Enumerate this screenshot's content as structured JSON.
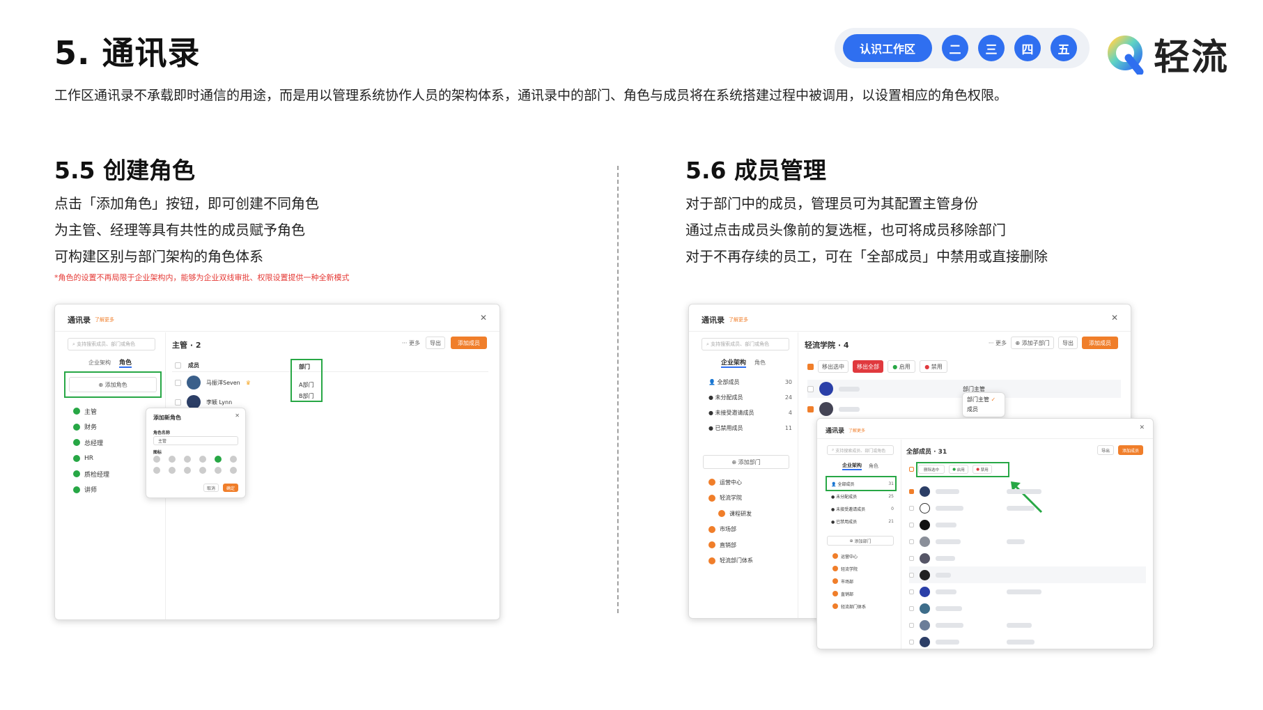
{
  "header": {
    "title": "5. 通讯录",
    "description": "工作区通讯录不承载即时通信的用途，而是用以管理系统协作人员的架构体系，通讯录中的部门、角色与成员将在系统搭建过程中被调用，以设置相应的角色权限。",
    "steps": [
      "认识工作区",
      "二",
      "三",
      "四",
      "五"
    ],
    "logo_text": "轻流"
  },
  "left": {
    "title": "5.5 创建角色",
    "lines": [
      "点击「添加角色」按钮，即可创建不同角色",
      "为主管、经理等具有共性的成员赋予角色",
      "可构建区别与部门架构的角色体系"
    ],
    "note": "*角色的设置不再局限于企业架构内，能够为企业双线审批、权限设置提供一种全新模式",
    "app": {
      "window_title": "通讯录",
      "learn_more": "了解更多",
      "search_placeholder": "支持搜索成员、部门或角色",
      "tabs": [
        "企业架构",
        "角色"
      ],
      "add_role": "添加角色",
      "roles": [
        "主管",
        "财务",
        "总经理",
        "HR",
        "质检经理",
        "讲师"
      ],
      "list_title": "主管 · 2",
      "more": "更多",
      "export": "导出",
      "add_member": "添加成员",
      "col_member": "成员",
      "col_dept": "部门",
      "members": [
        "马振洋Seven",
        "李颖 Lynn"
      ],
      "depts": [
        "A部门",
        "B部门"
      ],
      "dialog": {
        "title": "添加新角色",
        "name_label": "角色名称",
        "name_value": "主管",
        "icon_label": "图标",
        "cancel": "取消",
        "ok": "确定"
      }
    }
  },
  "right": {
    "title": "5.6 成员管理",
    "lines": [
      "对于部门中的成员，管理员可为其配置主管身份",
      "通过点击成员头像前的复选框，也可将成员移除部门",
      "对于不再存续的员工，可在「全部成员」中禁用或直接删除"
    ],
    "app1": {
      "window_title": "通讯录",
      "learn_more": "了解更多",
      "search_placeholder": "支持搜索成员、部门或角色",
      "tabs": [
        "企业架构",
        "角色"
      ],
      "stats": [
        {
          "label": "全部成员",
          "count": "30"
        },
        {
          "label": "未分配成员",
          "count": "24"
        },
        {
          "label": "未接受邀请成员",
          "count": "4"
        },
        {
          "label": "已禁用成员",
          "count": "11"
        }
      ],
      "add_dept": "添加部门",
      "depts": [
        "运营中心",
        "轻流学院",
        "课程研发",
        "市场部",
        "直销部",
        "轻流部门体系"
      ],
      "list_title": "轻流学院 · 4",
      "more": "更多",
      "add_sub_dept": "添加子部门",
      "export": "导出",
      "add_member": "添加成员",
      "actions": [
        "移出选中",
        "移出全部",
        "启用",
        "禁用"
      ],
      "role_head": "部门主管",
      "role_member": "成员",
      "dropdown": [
        "部门主管",
        "成员"
      ]
    },
    "app2": {
      "window_title": "通讯录",
      "learn_more": "了解更多",
      "search_placeholder": "支持搜索成员、部门或角色",
      "tabs": [
        "企业架构",
        "角色"
      ],
      "stats": [
        {
          "label": "全部成员",
          "count": "31"
        },
        {
          "label": "未分配成员",
          "count": "25"
        },
        {
          "label": "未接受邀请成员",
          "count": "0"
        },
        {
          "label": "已禁用成员",
          "count": "21"
        }
      ],
      "add_dept": "添加部门",
      "depts": [
        "运营中心",
        "轻流学院",
        "市场部",
        "直销部",
        "轻流部门体系"
      ],
      "list_title": "全部成员 · 31",
      "export": "导出",
      "add_member": "添加成员",
      "actions": [
        "删除选中",
        "启用",
        "禁用"
      ]
    }
  },
  "colors": {
    "accent_blue": "#2f6ff0",
    "accent_orange": "#f07e2a",
    "highlight_green": "#27a745",
    "danger_red": "#e0393e"
  }
}
